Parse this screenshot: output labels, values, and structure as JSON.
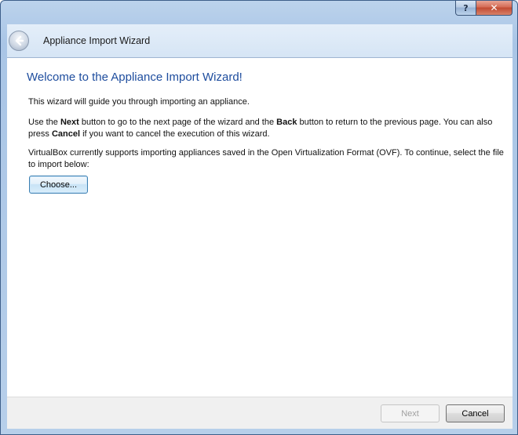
{
  "window": {
    "help_label": "?",
    "close_label": "✕"
  },
  "header": {
    "title": "Appliance Import Wizard",
    "back_icon": "back-arrow-icon"
  },
  "page": {
    "heading": "Welcome to the Appliance Import Wizard!",
    "intro": "This wizard will guide you through importing an appliance.",
    "nav_text": {
      "p1": "Use the ",
      "next_word": "Next",
      "p2": " button to go to the next page of the wizard and the ",
      "back_word": "Back",
      "p3": " button to return to the previous page. You can also press ",
      "cancel_word": "Cancel",
      "p4": " if you want to cancel the execution of this wizard."
    },
    "ovf_text": "VirtualBox currently supports importing appliances saved in the Open Virtualization Format (OVF). To continue, select the file to import below:",
    "choose_label": "Choose..."
  },
  "footer": {
    "next_label": "Next",
    "cancel_label": "Cancel"
  }
}
